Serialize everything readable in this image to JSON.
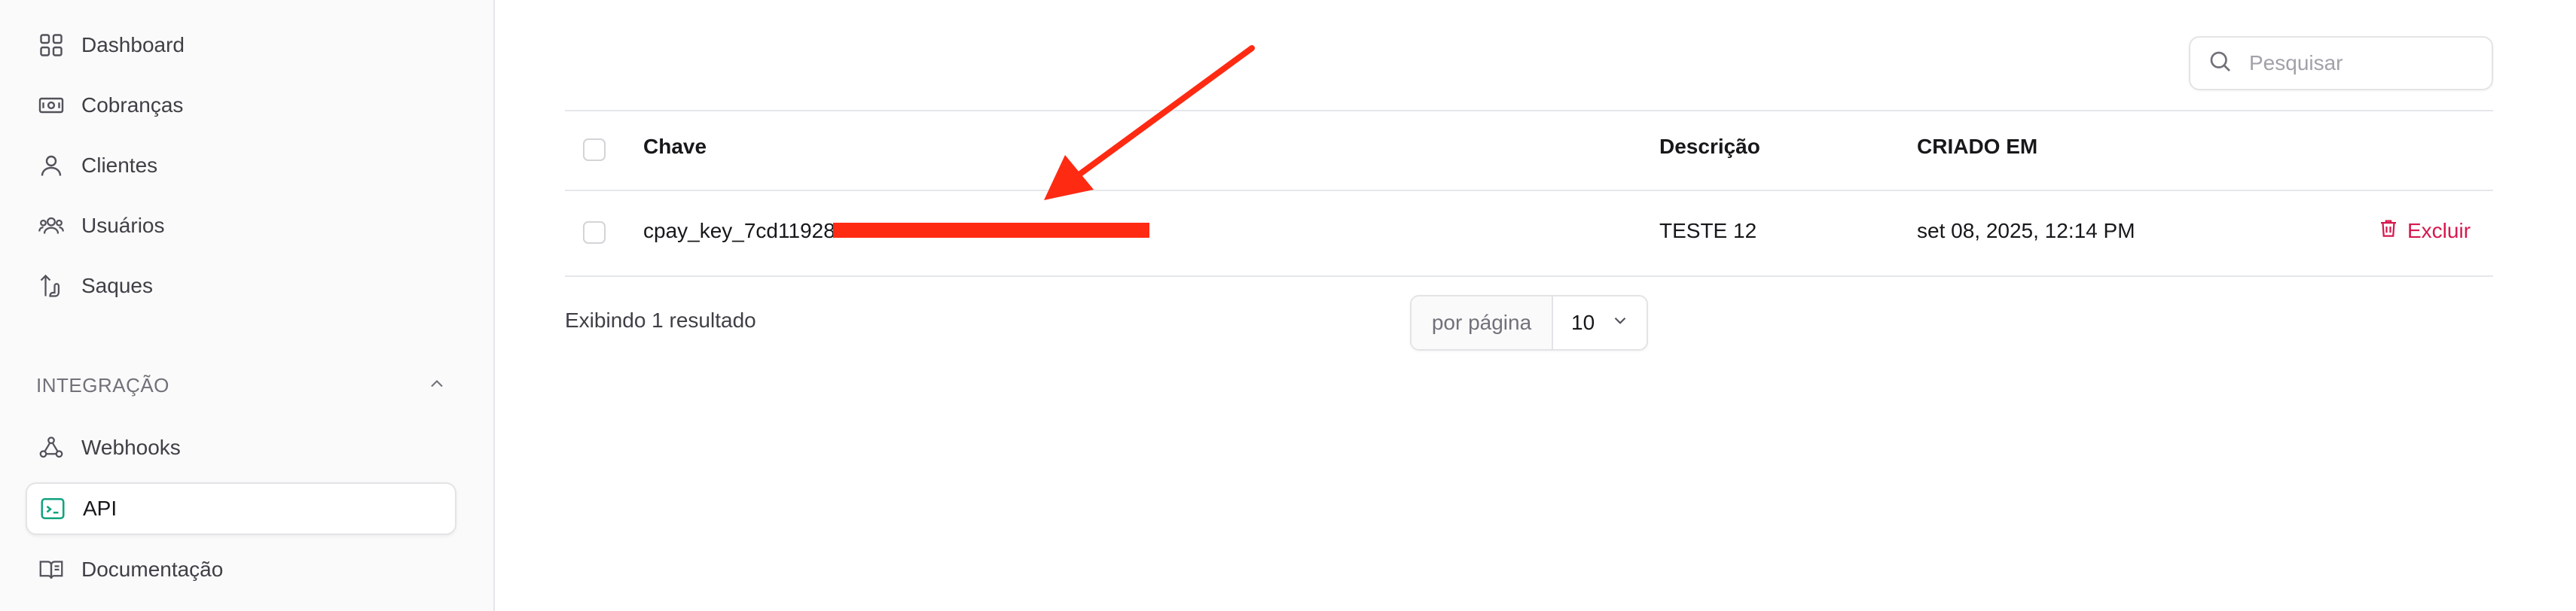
{
  "sidebar": {
    "items": [
      {
        "label": "Dashboard",
        "icon": "dashboard-grid-icon"
      },
      {
        "label": "Cobranças",
        "icon": "money-bill-icon"
      },
      {
        "label": "Clientes",
        "icon": "user-icon"
      },
      {
        "label": "Usuários",
        "icon": "users-icon"
      },
      {
        "label": "Saques",
        "icon": "withdraw-icon"
      }
    ],
    "section": {
      "label": "INTEGRAÇÃO",
      "icon": "chevron-up-icon",
      "expanded": true
    },
    "integration_items": [
      {
        "label": "Webhooks",
        "icon": "webhook-icon",
        "active": false
      },
      {
        "label": "API",
        "icon": "terminal-icon",
        "active": true
      },
      {
        "label": "Documentação",
        "icon": "book-open-icon",
        "active": false
      }
    ]
  },
  "search": {
    "placeholder": "Pesquisar",
    "value": ""
  },
  "table": {
    "columns": [
      "Chave",
      "Descrição",
      "CRIADO EM"
    ],
    "rows": [
      {
        "key": "cpay_key_7cd11928",
        "description": "TESTE 12",
        "created": "set 08, 2025, 12:14 PM",
        "action": "Excluir"
      }
    ]
  },
  "pagination": {
    "result_text": "Exibindo 1 resultado",
    "per_page_label": "por página",
    "per_page_value": "10"
  },
  "colors": {
    "accent_active": "#10a37f",
    "danger": "#d6184e",
    "annotation": "#ff2a12"
  }
}
